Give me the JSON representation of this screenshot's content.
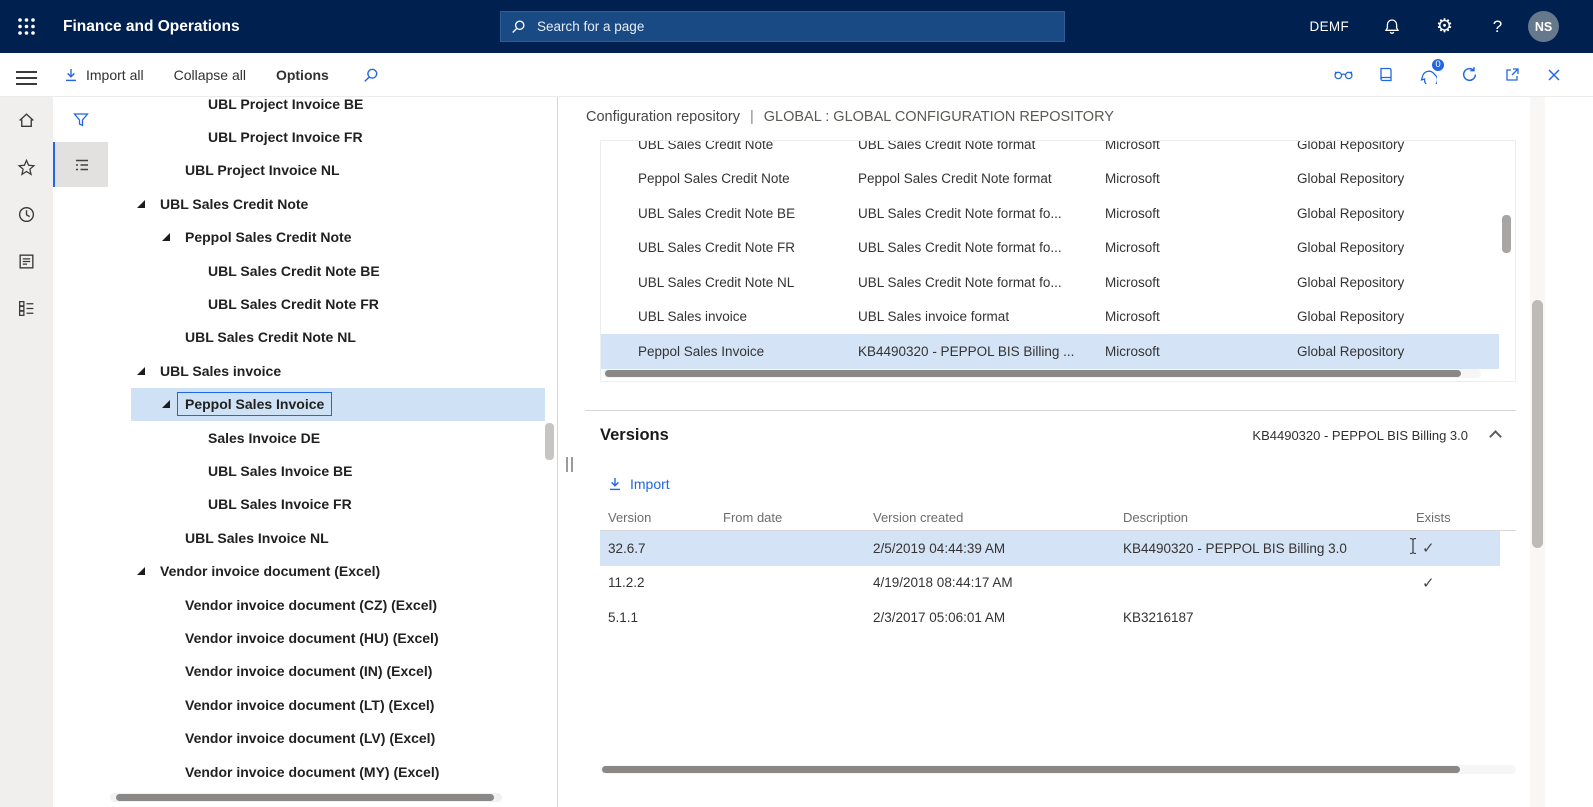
{
  "icons": {
    "gear": "⚙",
    "help": "?"
  },
  "colors": {
    "accent": "#2266E3",
    "topbar_bg": "#002050",
    "selection": "#d5e3f6"
  },
  "topbar": {
    "title": "Finance and Operations",
    "search_placeholder": "Search for a page",
    "company": "DEMF",
    "avatar": "NS"
  },
  "actionbar": {
    "import_all": "Import all",
    "collapse_all": "Collapse all",
    "options": "Options",
    "message_count": "0"
  },
  "breadcrumb": {
    "page": "Configuration repository",
    "separator": "|",
    "context": "GLOBAL : GLOBAL CONFIGURATION REPOSITORY"
  },
  "tree": {
    "items": [
      {
        "label": "UBL Project Invoice BE",
        "level": 2
      },
      {
        "label": "UBL Project Invoice FR",
        "level": 2
      },
      {
        "label": "UBL Project Invoice NL",
        "level": 1
      },
      {
        "label": "UBL Sales Credit Note",
        "level": 0,
        "expanded": true
      },
      {
        "label": "Peppol Sales Credit Note",
        "level": 1,
        "expanded": true
      },
      {
        "label": "UBL Sales Credit Note BE",
        "level": 2
      },
      {
        "label": "UBL Sales Credit Note FR",
        "level": 2
      },
      {
        "label": "UBL Sales Credit Note NL",
        "level": 1
      },
      {
        "label": "UBL Sales invoice",
        "level": 0,
        "expanded": true
      },
      {
        "label": "Peppol Sales Invoice",
        "level": 1,
        "expanded": true,
        "selected": true
      },
      {
        "label": "Sales Invoice DE",
        "level": 2
      },
      {
        "label": "UBL Sales Invoice BE",
        "level": 2
      },
      {
        "label": "UBL Sales Invoice FR",
        "level": 2
      },
      {
        "label": "UBL Sales Invoice NL",
        "level": 1
      },
      {
        "label": "Vendor invoice document (Excel)",
        "level": 0,
        "expanded": true
      },
      {
        "label": "Vendor invoice document (CZ) (Excel)",
        "level": 1
      },
      {
        "label": "Vendor invoice document (HU) (Excel)",
        "level": 1
      },
      {
        "label": "Vendor invoice document (IN) (Excel)",
        "level": 1
      },
      {
        "label": "Vendor invoice document (LT) (Excel)",
        "level": 1
      },
      {
        "label": "Vendor invoice document (LV) (Excel)",
        "level": 1
      },
      {
        "label": "Vendor invoice document (MY) (Excel)",
        "level": 1
      }
    ]
  },
  "repo_grid": {
    "rows": [
      {
        "name": "UBL Sales Credit Note",
        "description": "UBL Sales Credit Note format",
        "provider": "Microsoft",
        "repository": "Global Repository"
      },
      {
        "name": "Peppol Sales Credit Note",
        "description": "Peppol Sales Credit Note format",
        "provider": "Microsoft",
        "repository": "Global Repository"
      },
      {
        "name": "UBL Sales Credit Note BE",
        "description": "UBL Sales Credit Note format fo...",
        "provider": "Microsoft",
        "repository": "Global Repository"
      },
      {
        "name": "UBL Sales Credit Note FR",
        "description": "UBL Sales Credit Note format fo...",
        "provider": "Microsoft",
        "repository": "Global Repository"
      },
      {
        "name": "UBL Sales Credit Note NL",
        "description": "UBL Sales Credit Note format fo...",
        "provider": "Microsoft",
        "repository": "Global Repository"
      },
      {
        "name": "UBL Sales invoice",
        "description": "UBL Sales invoice format",
        "provider": "Microsoft",
        "repository": "Global Repository"
      },
      {
        "name": "Peppol Sales Invoice",
        "description": "KB4490320 - PEPPOL BIS Billing ...",
        "provider": "Microsoft",
        "repository": "Global Repository",
        "selected": true
      }
    ]
  },
  "versions": {
    "title": "Versions",
    "reference": "KB4490320 - PEPPOL BIS Billing 3.0",
    "import_label": "Import",
    "columns": [
      "Version",
      "From date",
      "Version created",
      "Description",
      "Exists"
    ],
    "rows": [
      {
        "version": "32.6.7",
        "from_date": "",
        "created": "2/5/2019 04:44:39 AM",
        "description": "KB4490320 - PEPPOL BIS Billing 3.0",
        "exists": "✓",
        "selected": true
      },
      {
        "version": "11.2.2",
        "from_date": "",
        "created": "4/19/2018 08:44:17 AM",
        "description": "",
        "exists": "✓",
        "selected": false
      },
      {
        "version": "5.1.1",
        "from_date": "",
        "created": "2/3/2017 05:06:01 AM",
        "description": "KB3216187",
        "exists": "",
        "selected": false
      }
    ]
  }
}
